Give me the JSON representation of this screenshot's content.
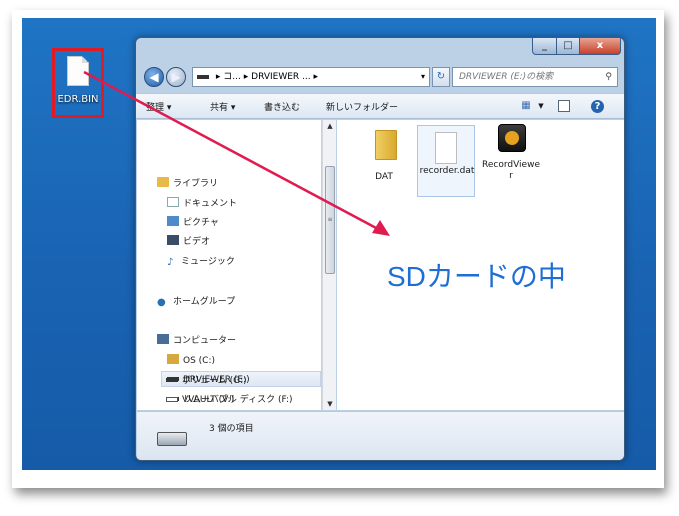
{
  "desktop": {
    "file_icon": {
      "label": "EDR.BIN"
    }
  },
  "window": {
    "controls": {
      "minimize": "_",
      "maximize": "□",
      "close": "x"
    },
    "address": {
      "crumbs": [
        "コ...",
        "DRVIEWER ..."
      ],
      "separator": "▸",
      "dropdown": "▾"
    },
    "refresh_symbol": "↻",
    "search": {
      "placeholder": "DRVIEWER (E:)の検索",
      "icon": "⚲"
    },
    "toolbar": {
      "organize": "整理 ▾",
      "share": "共有 ▾",
      "burn": "書き込む",
      "new_folder": "新しいフォルダー",
      "help_symbol": "?"
    },
    "nav": {
      "library": "ライブラリ",
      "documents": "ドキュメント",
      "pictures": "ピクチャ",
      "videos": "ビデオ",
      "music": "ミュージック",
      "homegroup": "ホームグループ",
      "computer": "コンピューター",
      "drive_c": "OS (C:)",
      "drive_e": "DRVIEWER (E:)",
      "drive_f": "リムーバブル ディスク (F:)",
      "drive_g": "ボリューム (G:)",
      "drive_v": "VVAULT (V:)"
    },
    "files": [
      {
        "label": "DAT"
      },
      {
        "label": "recorder.dat"
      },
      {
        "label": "RecordViewer"
      }
    ],
    "status": {
      "count_text": "3 個の項目"
    }
  },
  "annotation": {
    "text": "SDカードの中",
    "color": "#1e6ed4"
  },
  "arrow": {
    "color": "#e01b4f"
  }
}
